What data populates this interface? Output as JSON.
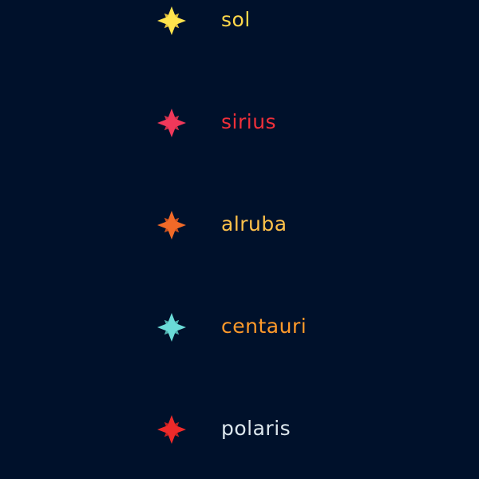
{
  "background": "#00112b",
  "stars": [
    {
      "name": "sol",
      "star_color": "#ffe34d",
      "star_shade": "#e0bf3a",
      "text_color": "#ffd84a"
    },
    {
      "name": "sirius",
      "star_color": "#f0385a",
      "star_shade": "#c83048",
      "text_color": "#f0303a"
    },
    {
      "name": "alruba",
      "star_color": "#f06a28",
      "star_shade": "#c8501e",
      "text_color": "#ffc24a"
    },
    {
      "name": "centauri",
      "star_color": "#6adbd8",
      "star_shade": "#4fb0ae",
      "text_color": "#ff9a2a"
    },
    {
      "name": "polaris",
      "star_color": "#ee2a2a",
      "star_shade": "#c02020",
      "text_color": "#dde8ee"
    }
  ]
}
